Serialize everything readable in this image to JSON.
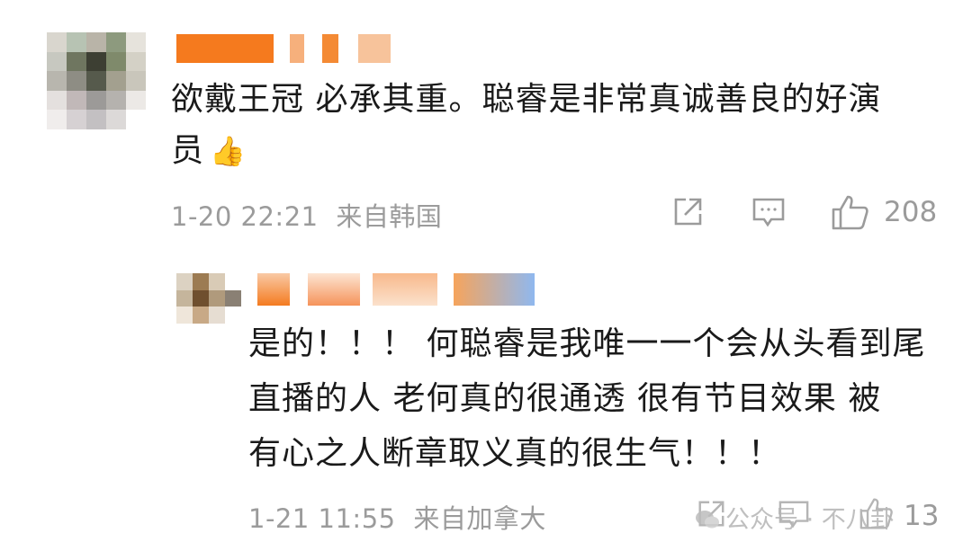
{
  "comments": [
    {
      "text_line1": "欲戴王冠 必承其重。聪睿是非常真诚善良的好演",
      "text_line2": "员",
      "emoji": "👍",
      "timestamp": "1-20 22:21",
      "location": "来自韩国",
      "like_count": "208",
      "icons": [
        "share-icon",
        "comment-icon",
        "like-icon"
      ]
    },
    {
      "text_line1": "是的！！！ 何聪睿是我唯一一个会从头看到尾",
      "text_line2": "直播的人 老何真的很通透 很有节目效果 被",
      "text_line3": "有心之人断章取义真的很生气！！！",
      "timestamp": "1-21 11:55",
      "location": "来自加拿大",
      "like_count": "13",
      "icons": [
        "share-icon",
        "comment-icon",
        "like-icon"
      ]
    }
  ],
  "watermark": {
    "text": "公众号 · 不八卦"
  },
  "colors": {
    "text": "#1a1a1a",
    "meta": "#9b9b9b",
    "name_orange": "#f47b20",
    "background": "#ffffff"
  }
}
